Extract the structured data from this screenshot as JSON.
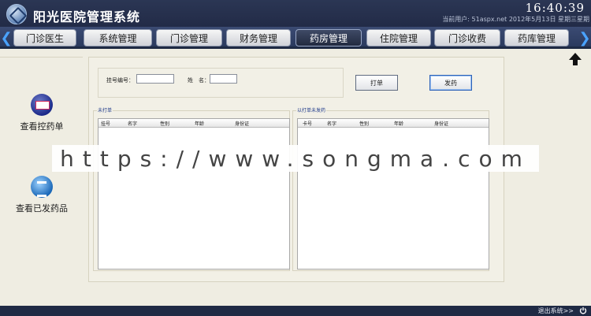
{
  "header": {
    "title": "阳光医院管理系统",
    "clock": "16:40:39",
    "user_line": "当前用户: 51aspx.net  2012年5月13日 星期三星期"
  },
  "nav": {
    "tabs": [
      {
        "label": "门诊医生"
      },
      {
        "label": "系统管理"
      },
      {
        "label": "门诊管理"
      },
      {
        "label": "财务管理"
      },
      {
        "label": "药房管理",
        "active": true
      },
      {
        "label": "住院管理"
      },
      {
        "label": "门诊收费"
      },
      {
        "label": "药库管理"
      }
    ]
  },
  "sidebar": {
    "items": [
      {
        "label": "查看控药单",
        "icon": "prescription-icon"
      },
      {
        "label": "查看已发药品",
        "icon": "dispensed-icon"
      }
    ]
  },
  "search": {
    "reg_no_label": "挂号编号：",
    "name_label": "姓　名：",
    "reg_no_value": "",
    "name_value": ""
  },
  "buttons": {
    "print_label": "打单",
    "dispense_label": "发药"
  },
  "unprinted": {
    "title": "未打单",
    "columns": [
      "挂号",
      "名字",
      "性别",
      "年龄",
      "身份证"
    ]
  },
  "printed": {
    "title": "以打单未发药",
    "columns": [
      "卡号",
      "名字",
      "性别",
      "年龄",
      "身份证"
    ]
  },
  "watermark": "https://www.songma.com",
  "footer": {
    "exit_label": "退出系统>>"
  },
  "colors": {
    "header_bg": "#222b47",
    "accent": "#4aa3ff",
    "page_bg": "#efede2"
  }
}
